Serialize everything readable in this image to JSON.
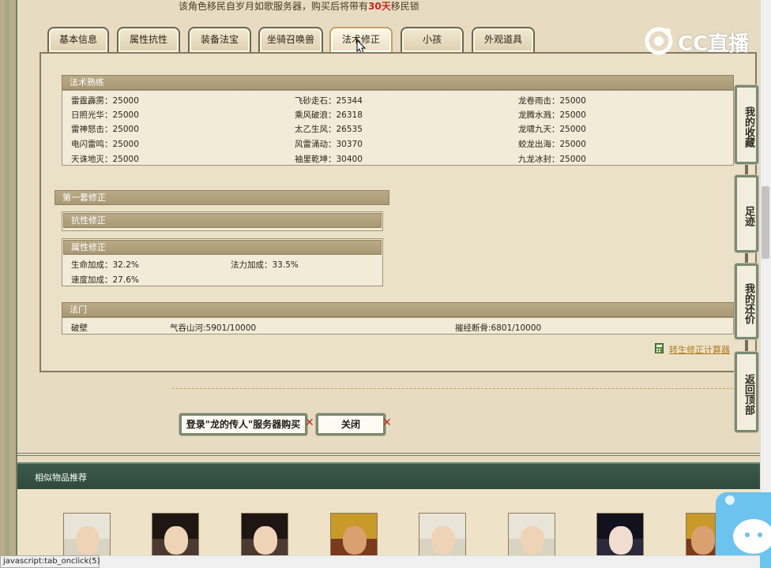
{
  "notice": {
    "prefix": "该角色移民自岁月如歌服务器，购买后将带有",
    "highlight": "30天",
    "suffix": "移民锁"
  },
  "tabs": [
    "基本信息",
    "属性抗性",
    "装备法宝",
    "坐骑召唤兽",
    "法术修正",
    "小孩",
    "外观道具"
  ],
  "active_tab": "法术修正",
  "spell_mastery": {
    "title": "法术熟练",
    "rows": [
      [
        "雷霆霹雳：25000",
        "飞砂走石：25344",
        "龙卷雨击：25000"
      ],
      [
        "日照光华：25000",
        "乘风破浪：26318",
        "龙腾水溅：25000"
      ],
      [
        "雷神怒击：25000",
        "太乙生风：26535",
        "龙啸九天：25000"
      ],
      [
        "电闪雷鸣：25000",
        "风雷涌动：30370",
        "蛟龙出海：25000"
      ],
      [
        "天诛地灭：25000",
        "袖里乾坤：30400",
        "九龙冰封：25000"
      ]
    ]
  },
  "first_set": {
    "title": "第一套修正",
    "resist_title": "抗性修正",
    "attr_title": "属性修正",
    "attrs": [
      "生命加成：32.2%",
      "法力加成：33.5%",
      "速度加成：27.6%"
    ]
  },
  "fa_men": {
    "title": "法门",
    "items": [
      "破壁",
      "气吞山河:5901/10000",
      "摧经断骨:6801/10000"
    ]
  },
  "calc_link": "转生修正计算器",
  "sidebar": [
    "我的收藏",
    "足迹",
    "我的还价",
    "返回顶部"
  ],
  "buttons": {
    "login_buy": "登录\"龙的传人\"服务器购买",
    "close": "关闭",
    "x": "✕"
  },
  "similar_title": "相似物品推荐",
  "status_text": "javascript:tab_onclick(5);",
  "watermark": "CC直播",
  "colors": {
    "accent_red": "#c8281e",
    "header": "#ac9c78",
    "dark_green": "#2f4a3d"
  }
}
